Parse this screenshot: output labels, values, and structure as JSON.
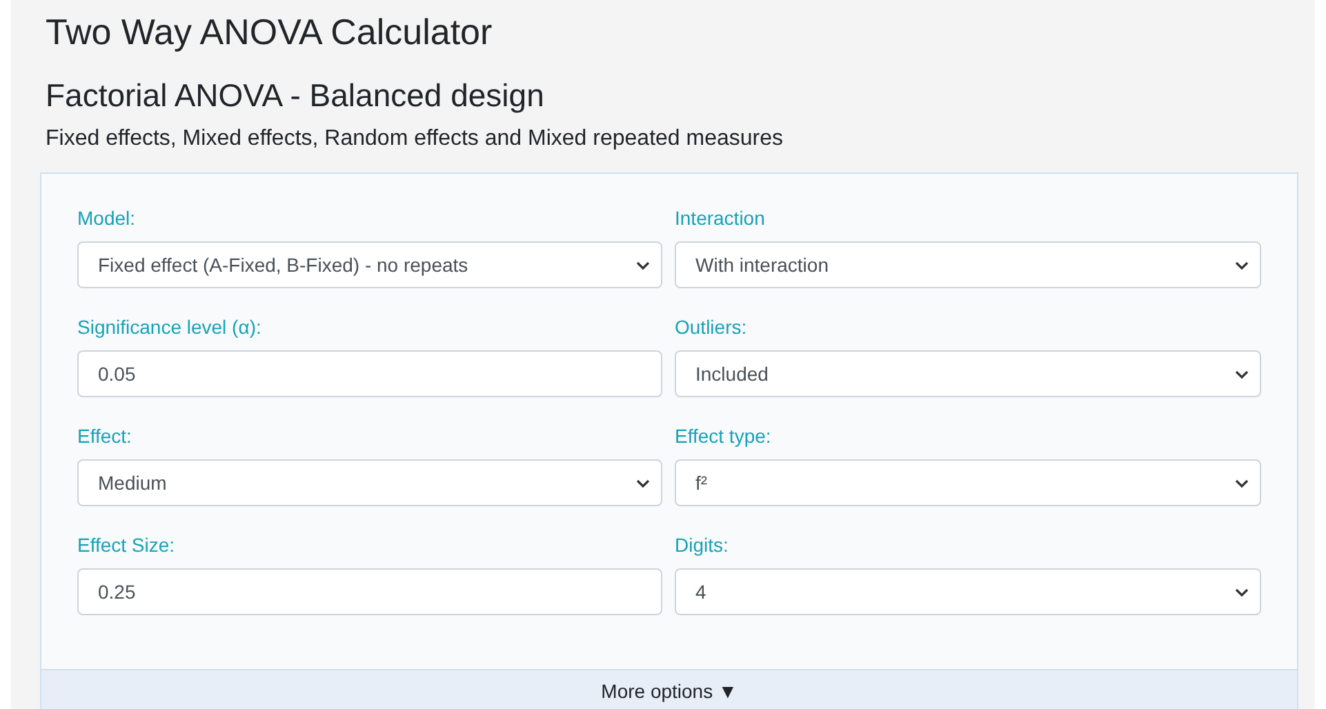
{
  "title": "Two Way ANOVA Calculator",
  "subtitle": "Factorial ANOVA - Balanced design",
  "description": "Fixed effects, Mixed effects, Random effects and Mixed repeated measures",
  "fields": [
    {
      "label": "Model:",
      "kind": "select",
      "value": "Fixed effect (A-Fixed, B-Fixed) - no repeats"
    },
    {
      "label": "Interaction",
      "kind": "select",
      "value": "With interaction"
    },
    {
      "label": "Significance level (α):",
      "kind": "input",
      "value": "0.05"
    },
    {
      "label": "Outliers:",
      "kind": "select",
      "value": "Included"
    },
    {
      "label": "Effect:",
      "kind": "select",
      "value": "Medium"
    },
    {
      "label": "Effect type:",
      "kind": "select",
      "value": "f²"
    },
    {
      "label": "Effect Size:",
      "kind": "input",
      "value": "0.25"
    },
    {
      "label": "Digits:",
      "kind": "select",
      "value": "4"
    }
  ],
  "more_options": "More options ▼"
}
